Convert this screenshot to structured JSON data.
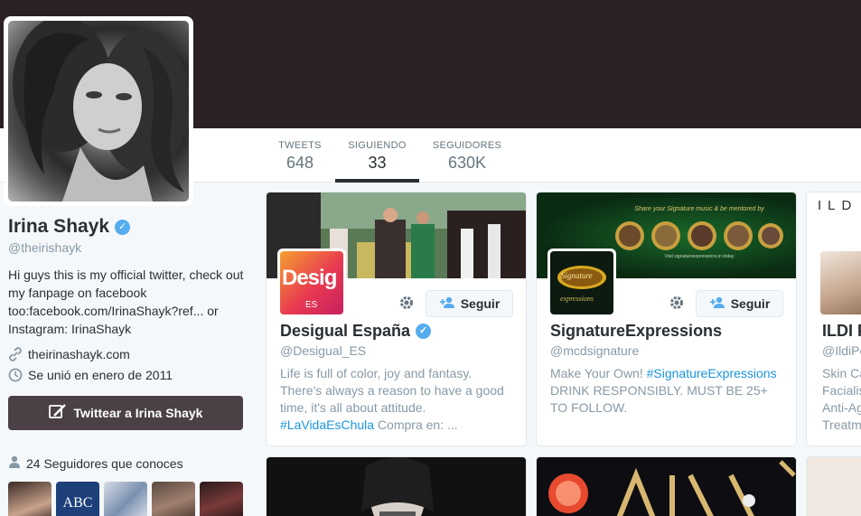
{
  "nav": {
    "items": [
      {
        "label": "TWEETS",
        "value": "648",
        "active": false
      },
      {
        "label": "SIGUIENDO",
        "value": "33",
        "active": true
      },
      {
        "label": "SEGUIDORES",
        "value": "630K",
        "active": false
      }
    ]
  },
  "profile": {
    "name": "Irina Shayk",
    "verified_mark": "✓",
    "handle": "@theirishayk",
    "bio": "Hi guys this is my official twitter, check out my fanpage on facebook too:facebook.com/IrinaShayk?ref... or Instagram: IrinaShayk",
    "website": "theirinashayk.com",
    "joined": "Se unió en enero de 2011",
    "tweet_button": "Twittear a Irina Shayk",
    "followers_you_know": "24 Seguidores que conoces"
  },
  "colors": {
    "accent": "#55acee",
    "link": "#1b95e0",
    "header": "#2a2025",
    "tweet_button": "#4a4045"
  },
  "icons": {
    "link": "link-icon",
    "calendar": "clock-icon",
    "gear": "gear-icon",
    "follow": "add-person-icon",
    "tweet": "compose-icon",
    "person": "person-icon"
  },
  "cards": [
    {
      "name": "Desigual España",
      "verified": true,
      "handle": "@Desigual_ES",
      "follow_label": "Seguir",
      "avatar_text": "Desig",
      "avatar_subtext": "ES",
      "bio_parts": [
        {
          "text": "Life is full of color, joy and fantasy. There's always a reason to have a good time, it's all about attitude. ",
          "tag": false
        },
        {
          "text": "#LaVidaEsChula",
          "tag": true
        },
        {
          "text": " Compra en: ...",
          "tag": false
        }
      ]
    },
    {
      "name": "SignatureExpressions",
      "verified": false,
      "handle": "@mcdsignature",
      "follow_label": "Seguir",
      "avatar_text": "Signature",
      "avatar_subtext": "expressions",
      "banner_text": "Share your Signature music & be mentored by",
      "banner_subtext": "Visit signatureexpressions.in today",
      "bio_parts": [
        {
          "text": "Make Your Own! ",
          "tag": false
        },
        {
          "text": "#SignatureExpressions",
          "tag": true
        },
        {
          "text": " DRINK RESPONSIBLY. MUST BE 25+ TO FOLLOW.",
          "tag": false
        }
      ]
    },
    {
      "name": "ILDI P",
      "handle": "@IldiPe",
      "banner_text": "ILD",
      "bio_lines": [
        "Skin Ca",
        "Facialis",
        "Anti-Ag",
        "Treatm"
      ]
    }
  ]
}
